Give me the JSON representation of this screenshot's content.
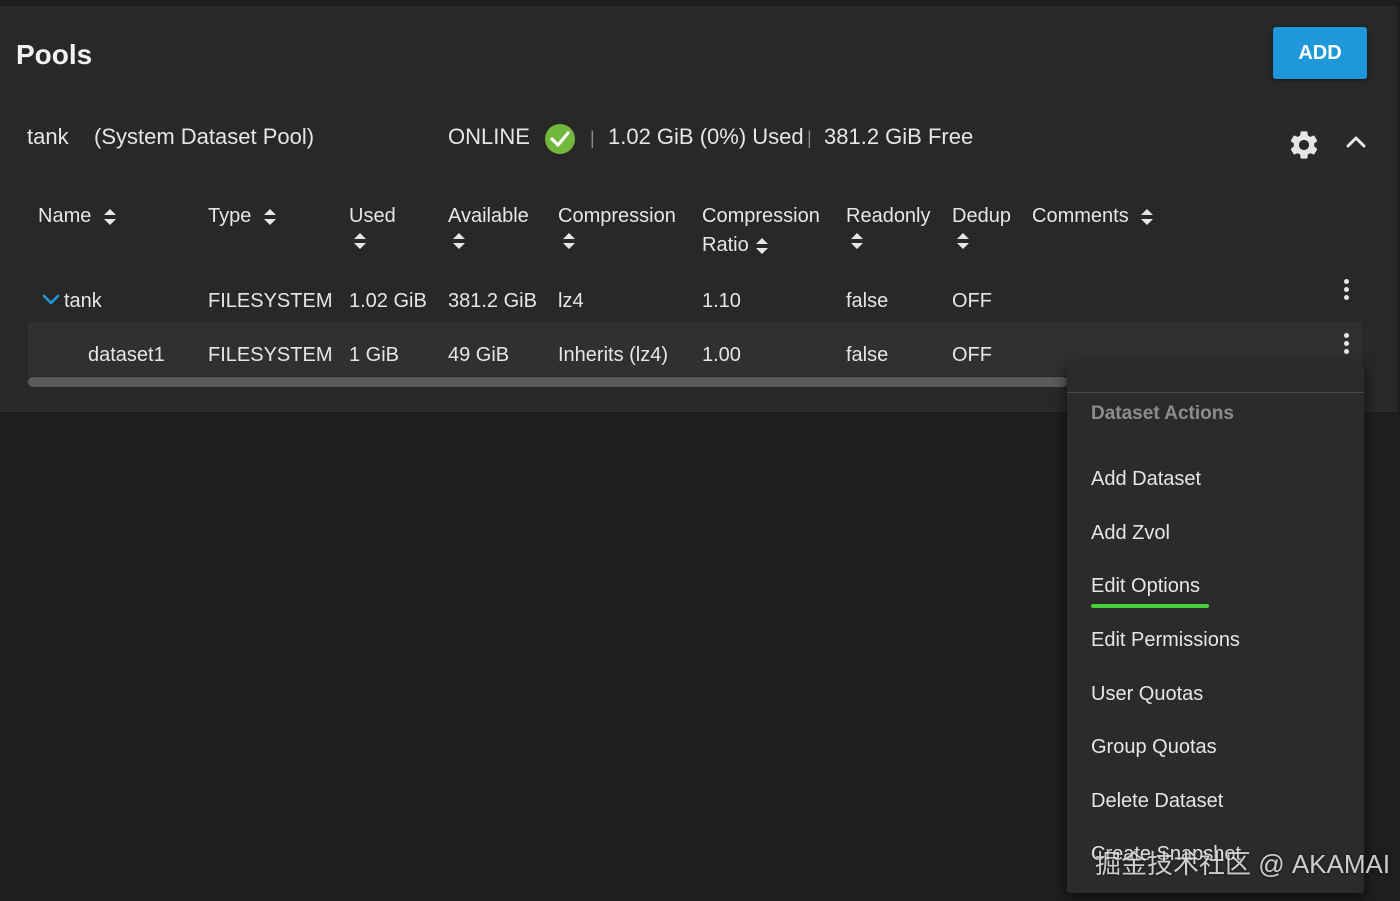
{
  "page": {
    "title": "Pools"
  },
  "toolbar": {
    "add_label": "ADD"
  },
  "pool": {
    "name": "tank",
    "label": "(System Dataset Pool)",
    "status": "ONLINE",
    "separator": "|",
    "used": "1.02 GiB (0%) Used",
    "free": "381.2 GiB Free",
    "icons": {
      "status": "check-circle-icon",
      "settings": "gear-icon",
      "collapse": "chevron-up-icon"
    },
    "status_color": "#71b83d"
  },
  "table": {
    "headers": {
      "name": "Name",
      "type": "Type",
      "used": "Used",
      "available": "Available",
      "compression": "Compression",
      "compression_ratio_1": "Compression",
      "compression_ratio_2": "Ratio",
      "readonly": "Readonly",
      "dedup": "Dedup",
      "comments": "Comments"
    },
    "rows": [
      {
        "name": "tank",
        "type": "FILESYSTEM",
        "used": "1.02 GiB",
        "available": "381.2 GiB",
        "compression": "lz4",
        "ratio": "1.10",
        "readonly": "false",
        "dedup": "OFF",
        "comments": ""
      },
      {
        "name": "dataset1",
        "type": "FILESYSTEM",
        "used": "1 GiB",
        "available": "49 GiB",
        "compression": "Inherits (lz4)",
        "ratio": "1.00",
        "readonly": "false",
        "dedup": "OFF",
        "comments": ""
      }
    ]
  },
  "menu": {
    "title": "Dataset Actions",
    "items": [
      "Add Dataset",
      "Add Zvol",
      "Edit Options",
      "Edit Permissions",
      "User Quotas",
      "Group Quotas",
      "Delete Dataset",
      "Create Snapshot"
    ],
    "highlight_color": "#44d13d"
  },
  "watermark": {
    "text": "掘金技术社区 @ AKAMAI"
  },
  "colors": {
    "accent": "#1e98d8",
    "background": "#1e1e1e",
    "card": "#282828"
  }
}
